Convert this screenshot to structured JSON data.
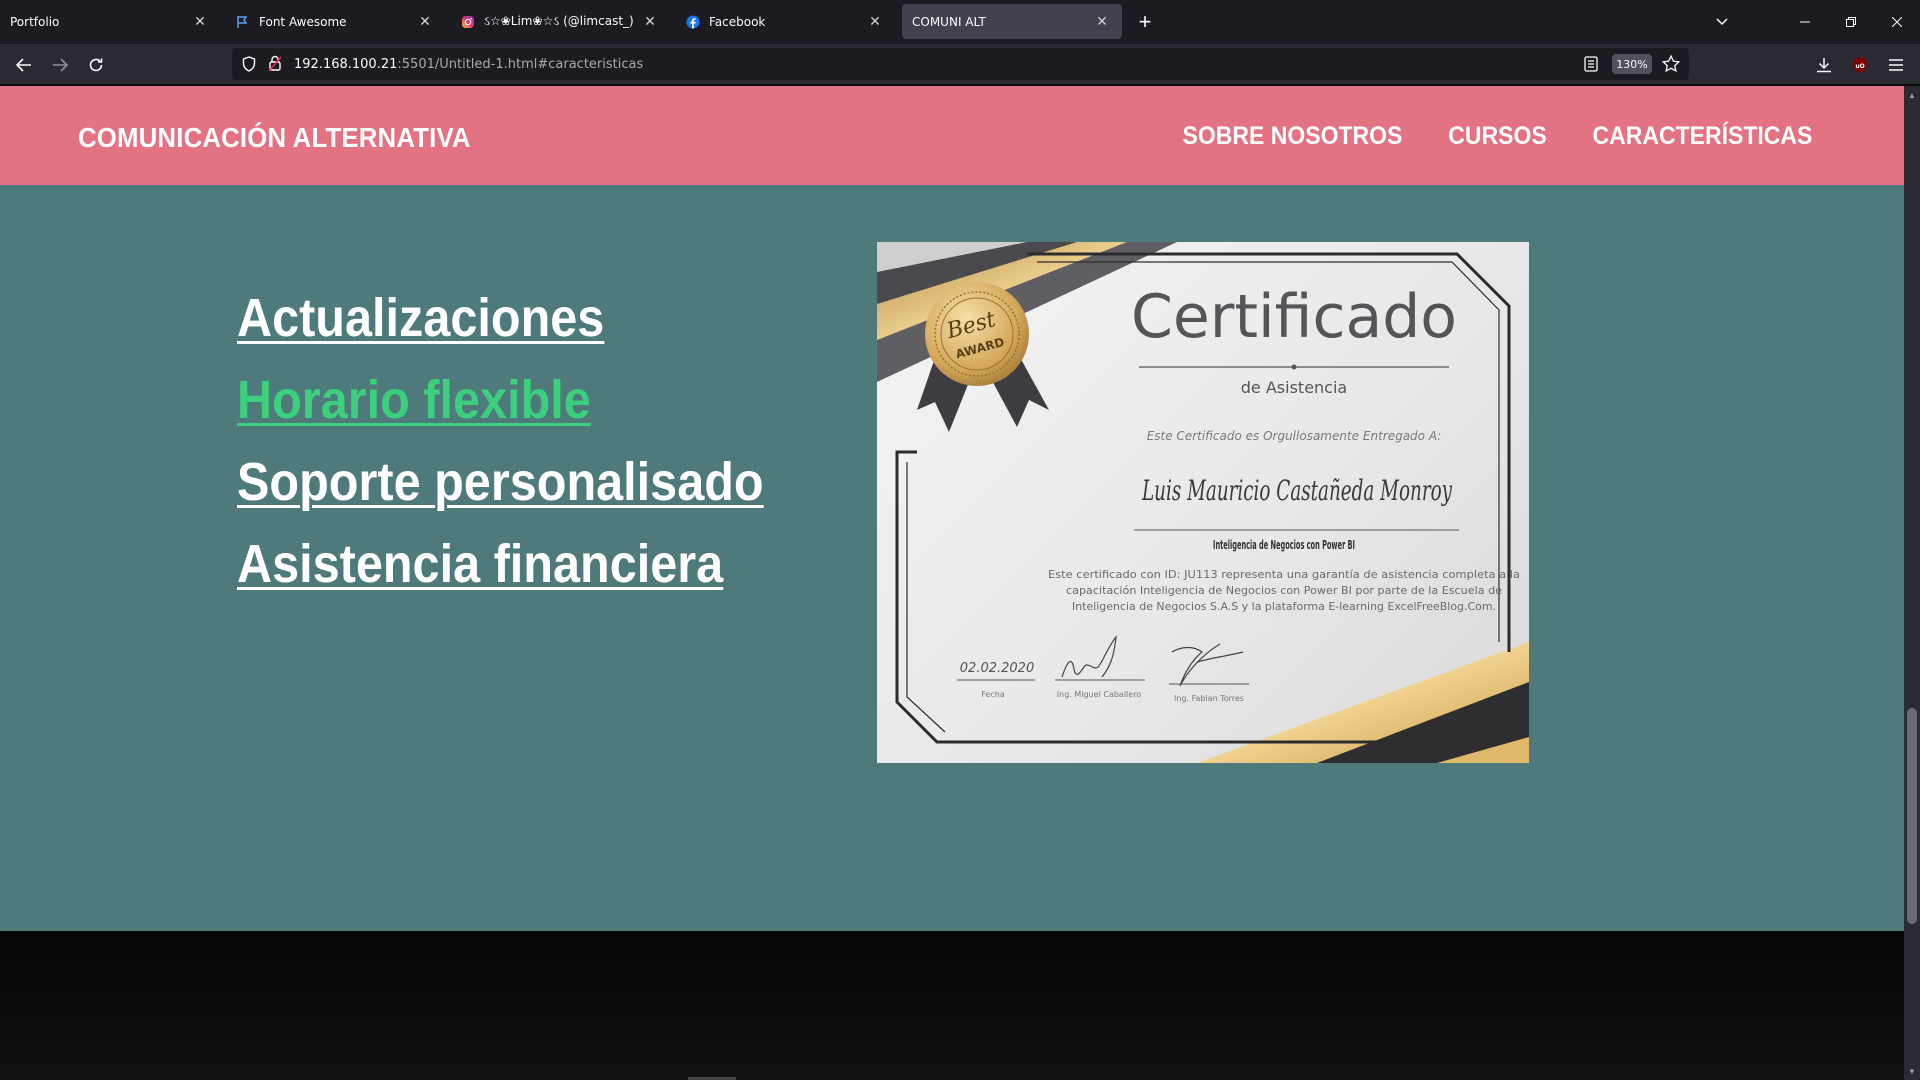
{
  "browser": {
    "tabs": [
      {
        "title": "Portfolio",
        "icon": "none",
        "active": false
      },
      {
        "title": "Font Awesome",
        "icon": "flag-icon",
        "active": false
      },
      {
        "title": "ઽ☆❀Lim❀☆ઽ (@limcast_)",
        "icon": "instagram-icon",
        "active": false
      },
      {
        "title": "Facebook",
        "icon": "facebook-icon",
        "active": false
      },
      {
        "title": "COMUNI ALT",
        "icon": "none",
        "active": true
      }
    ],
    "url": {
      "host": "192.168.100.21",
      "rest": ":5501/Untitled-1.html#caracteristicas"
    },
    "zoom": "130%"
  },
  "site": {
    "brand": "COMUNICACIÓN ALTERNATIVA",
    "nav": [
      "SOBRE NOSOTROS",
      "CURSOS",
      "CARACTERÍSTICAS"
    ],
    "features": [
      "Actualizaciones",
      "Horario flexible",
      "Soporte personalisado",
      "Asistencia financiera"
    ],
    "hovered_feature_index": 1
  },
  "certificate": {
    "title": "Certificado",
    "subtitle": "de Asistencia",
    "intro": "Este Certificado es Orgullosamente Entregado A:",
    "recipient": "Luis Mauricio Castañeda Monroy",
    "course": "Inteligencia de Negocios con Power BI",
    "body": [
      "Este certificado con ID: JU113 representa una garantía de asistencia completa a la",
      "capacitación Inteligencia de Negocios con Power BI por parte de la Escuela de",
      "Inteligencia de Negocios S.A.S y la plataforma E-learning ExcelFreeBlog.Com."
    ],
    "date": "02.02.2020",
    "date_label": "Fecha",
    "signer1": "Ing. Miguel Caballero",
    "signer2": "Ing. Fabian Torres",
    "badge_top": "Best",
    "badge_bottom": "AWARD"
  },
  "colors": {
    "header": "#e37383",
    "section": "#4f7a7b",
    "hover_link": "#3ccf7e",
    "gold": "#d9b468"
  }
}
